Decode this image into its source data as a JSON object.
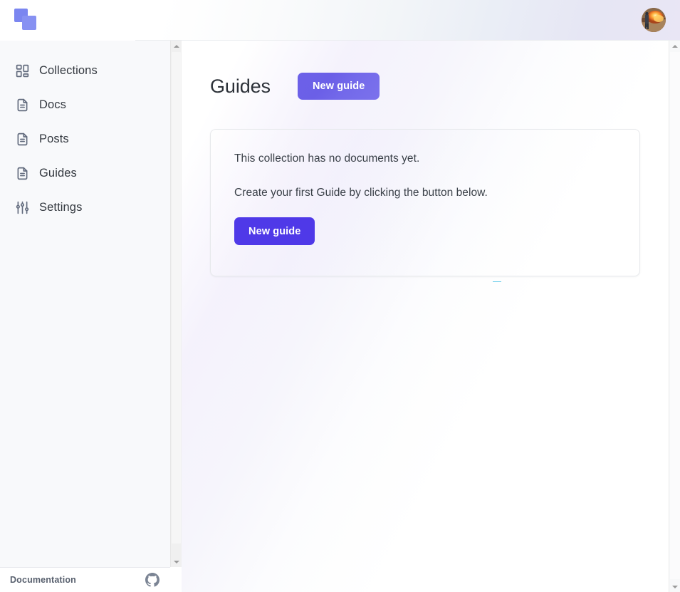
{
  "colors": {
    "brand_primary": "#4f39e8",
    "brand_gradient_start": "#6c61e8",
    "brand_gradient_end": "#7b72ec",
    "logo_square": "#7b86f0",
    "sidebar_bg": "#f8f9fb",
    "main_bg": "#ffffff",
    "text_primary": "#33383f",
    "text_body": "#3a4048",
    "icon_muted": "#626b7d",
    "card_border": "#e7e9ec",
    "accent_artifact": "#5bc8e8"
  },
  "header": {
    "logo_name": "app-logo",
    "avatar_name": "user-avatar"
  },
  "sidebar": {
    "items": [
      {
        "label": "Collections",
        "icon": "grid-layout-icon"
      },
      {
        "label": "Docs",
        "icon": "document-icon"
      },
      {
        "label": "Posts",
        "icon": "document-icon"
      },
      {
        "label": "Guides",
        "icon": "document-icon"
      },
      {
        "label": "Settings",
        "icon": "sliders-icon"
      }
    ],
    "footer": {
      "doc_label": "Documentation",
      "github_icon": "github-icon"
    }
  },
  "main": {
    "page_title": "Guides",
    "header_button_label": "New guide",
    "empty_card": {
      "line_1": "This collection has no documents yet.",
      "line_2": "Create your first Guide by clicking the button below.",
      "button_label": "New guide"
    }
  },
  "scrollbars": {
    "sidebar": {
      "up_icon": "triangle-up-icon",
      "down_icon": "triangle-down-icon"
    },
    "main": {
      "up_icon": "triangle-up-icon",
      "down_icon": "triangle-down-icon"
    }
  }
}
